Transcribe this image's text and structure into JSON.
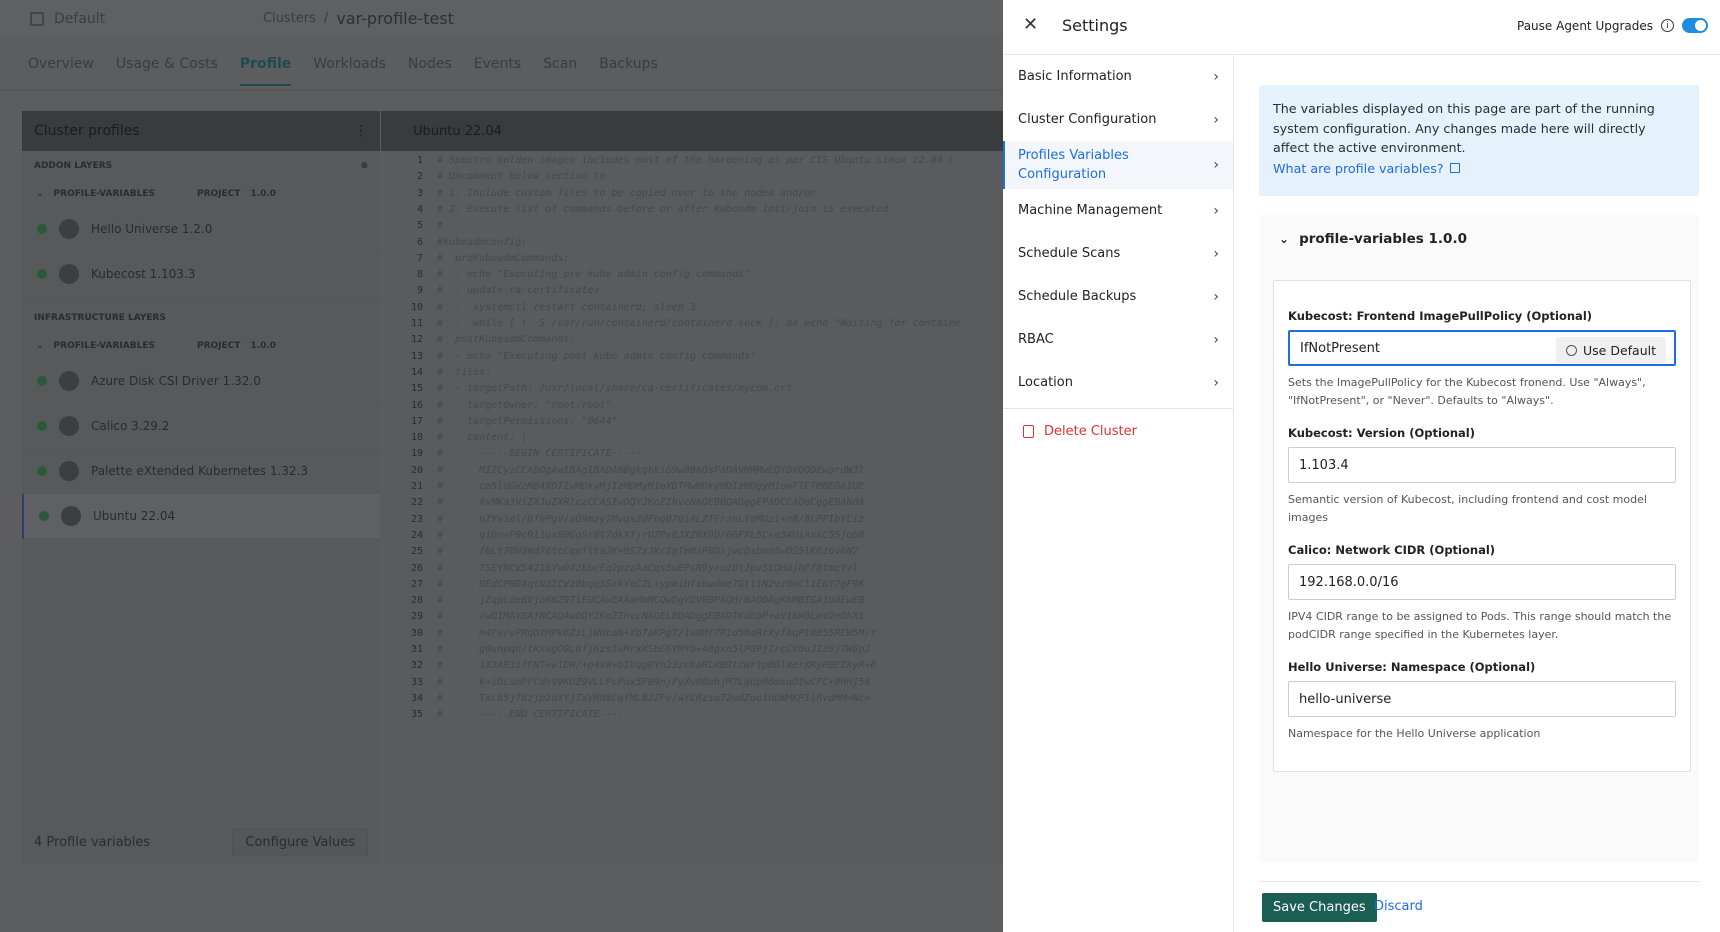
{
  "background": {
    "project": "Default",
    "breadcrumb_parent": "Clusters",
    "breadcrumb_sep": "/",
    "cluster_name": "var-profile-test",
    "tabs": [
      "Overview",
      "Usage & Costs",
      "Profile",
      "Workloads",
      "Nodes",
      "Events",
      "Scan",
      "Backups"
    ],
    "active_tab": "Profile",
    "panel_title": "Cluster profiles",
    "addon_layers": "ADDON LAYERS",
    "infra_layers": "INFRASTRUCTURE LAYERS",
    "profile_name": "PROFILE-VARIABLES",
    "scope": "PROJECT",
    "version": "1.0.0",
    "addon_packs": [
      "Hello Universe 1.2.0",
      "Kubecost 1.103.3"
    ],
    "infra_packs": [
      "Azure Disk CSI Driver 1.32.0",
      "Calico 3.29.2",
      "Palette eXtended Kubernetes 1.32.3",
      "Ubuntu 22.04"
    ],
    "profile_variables_count": "4 Profile variables",
    "configure_values": "Configure Values",
    "editor_title": "Ubuntu 22.04",
    "code_lines": [
      "# Spectro Golden images includes most of the hardening as per CIS Ubuntu Linux 22.04 L",
      "# Uncomment below section to",
      "# 1. Include custom files to be copied over to the nodes and/or",
      "# 2. Execute list of commands before or after kubeadm init/join is executed",
      "#",
      "#kubeadmconfig:",
      "#  preKubeadmCommands:",
      "#  - echo \"Executing pre kube admin config commands\"",
      "#  - update-ca-certificates",
      "#  - 'systemctl restart containerd; sleep 3'",
      "#  - 'while [ ! -S /var/run/containerd/containerd.sock ]; do echo \"Waiting for containe",
      "#  postKubeadmCommands:",
      "#  - echo \"Executing post kube admin config commands\"",
      "#  files:",
      "#  - targetPath: /usr/local/share/ca-certificates/mycom.crt",
      "#    targetOwner: \"root:root\"",
      "#    targetPermissions: \"0644\"",
      "#    content: |",
      "#      -----BEGIN CERTIFICATE-----",
      "#      MIICyzCCAbOgAwIBAgIBADANBgkqhkiG9w0BAQsFADAVMRMwEQYDVQQDEwprdWJl",
      "#      cm5ldGVzMB4XDTIwMDkyMjIzMDMyM1oXDTMwMDkyMDIzMDgyM1owFTETMBEGA1UE",
      "#      AxMKa3ViZXJuZXRlczCCASIwDQYJKoZIhvcNAQEBBQADggEPADCCAQoCggEBANdA",
      "#      nZYs1el/6f9PgV/aO9mzy7MvqsZdFnq07Qi4LZfFrznLYeMUzi+nB/8LPFIbYLiz",
      "#      qiDn+P9c9l1ux80GqSrBt7dkXfjrUZPs8JXZ0X9U/6GFXL5C+m3AUiAxXC55jobR",
      "#      fbLt7DH3Wd76tcCqeflta2K+9S7zJKcIgIm0iPNDijwcQsbon5wDS5lK6z6v6N2",
      "#      7SEYNCV5421bYw042kbcEq2pzzAaCqs5uEPsR9y+uzUtJpv5tOHdjbFf8tmcYvl",
      "#      9EdCP0DXqtN3ICVz0bqq5SxkYeC2L+ypmiHfxbwdWe7GtltN2vz0oCl1E6Y7gF9K",
      "#      jZqpLdeBVjoRNZ9TlFUCAwEAAaMmMCQwDgYDVR0PAQH/BAQDAgKkMBIGA1UdEwEB",
      "#      /wQIMAYBAf8CAQAwDQYJKoZIhvcNAQELBQADggEBADTKdEbP+aV16W9LmV2nDhXi",
      "#      m4Fv/vPRqDfMPk6ZzLjWUcaN+Xb7aKPgT/1a0Mf7R1d56aRrXyfAqPt8B55REW5M/Y",
      "#      g0unpqh/tKxagO9L0fj6zsIvMrxXSbE6YMYb+A8gxn5lP8PjIrcCV6uJIz0j7W6pJ",
      "#      iX3AR3ifFNT+w1DR/+p4xW+bIVqg0Yh23zc6aRLXB9tzWrtpBBlXerXRyR0EZkyR+6",
      "#      k+iDLumPFCdsV9KDZ9VLLPcPnx5F09njFyXv00ahjM7LgUpR6msuOIwCFC+0HHj56",
      "#      TxL65jf6zjp2aXYjTxVRN8CqfMLBJZFv/wYCRzsoT2wdZou1nDWMKP1lRvdMM=Nc=",
      "#      -----END CERTIFICATE-----"
    ]
  },
  "drawer": {
    "title": "Settings",
    "pause_label": "Pause Agent Upgrades",
    "nav": [
      {
        "label": "Basic Information"
      },
      {
        "label": "Cluster Configuration"
      },
      {
        "label": "Profiles Variables Configuration"
      },
      {
        "label": "Machine Management"
      },
      {
        "label": "Schedule Scans"
      },
      {
        "label": "Schedule Backups"
      },
      {
        "label": "RBAC"
      },
      {
        "label": "Location"
      }
    ],
    "active_nav": "Profiles Variables Configuration",
    "delete_label": "Delete Cluster",
    "notice_text": "The variables displayed on this page are part of the running system configuration. Any changes made here will directly affect the active environment.",
    "notice_link": "What are profile variables?",
    "group_title": "profile-variables 1.0.0",
    "fields": [
      {
        "label": "Kubecost: Frontend ImagePullPolicy (Optional)",
        "value": "IfNotPresent",
        "help": "Sets the ImagePullPolicy for the Kubecost fronend. Use \"Always\", \"IfNotPresent\", or \"Never\". Defaults to \"Always\"."
      },
      {
        "label": "Kubecost: Version (Optional)",
        "value": "1.103.4",
        "help": "Semantic version of Kubecost, including frontend and cost model images"
      },
      {
        "label": "Calico: Network CIDR (Optional)",
        "value": "192.168.0.0/16",
        "help": "IPV4 CIDR range to be assigned to Pods. This range should match the podCIDR range specified in the Kubernetes layer."
      },
      {
        "label": "Hello Universe: Namespace (Optional)",
        "value": "hello-universe",
        "help": "Namespace for the Hello Universe application"
      }
    ],
    "use_default": "Use Default",
    "save": "Save Changes",
    "discard": "Discard"
  },
  "colors": {
    "accent": "#1e6ee0",
    "save_bg": "#1b5e54",
    "danger": "#dd3333",
    "notice_bg": "#e5f1fb"
  },
  "icons": [
    "close-icon",
    "info-icon",
    "chevron-right-icon",
    "trash-icon",
    "external-link-icon",
    "chevron-down-icon",
    "history-icon"
  ]
}
